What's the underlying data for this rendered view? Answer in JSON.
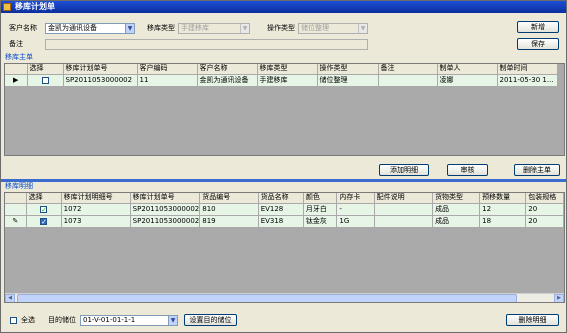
{
  "window": {
    "title": "移库计划单"
  },
  "form": {
    "customer_label": "客户名称",
    "customer_value": "金凯为通讯设备",
    "move_type_label": "移库类型",
    "move_type_value": "手建移库",
    "op_type_label": "操作类型",
    "op_type_value": "储位整理",
    "remark_label": "备注",
    "new_label": "新增",
    "save_label": "保存"
  },
  "master": {
    "section_title": "移库主单",
    "columns": [
      "选择",
      "移库计划单号",
      "客户编码",
      "客户名称",
      "移库类型",
      "操作类型",
      "备注",
      "制单人",
      "制单时间"
    ],
    "rows": [
      {
        "checked": false,
        "cells": [
          "SP2011053000002",
          "11",
          "金凯为通讯设备",
          "手建移库",
          "储位整理",
          "",
          "凌娜",
          "2011-05-30 1..."
        ]
      }
    ],
    "add_detail_label": "添加明细",
    "audit_label": "审核",
    "delete_main_label": "删除主单"
  },
  "detail": {
    "section_title": "移库明细",
    "columns": [
      "选择",
      "移库计划明细号",
      "移库计划单号",
      "货品编号",
      "货品名称",
      "颜色",
      "内存卡",
      "配件说明",
      "货物类型",
      "预移数量",
      "包装规格"
    ],
    "rows": [
      {
        "checked": true,
        "selected": false,
        "cells": [
          "1072",
          "SP2011053000002",
          "810",
          "EV128",
          "月牙白",
          "-",
          "",
          "成品",
          "12",
          "20"
        ]
      },
      {
        "checked": true,
        "selected": true,
        "cells": [
          "1073",
          "SP2011053000002",
          "819",
          "EV318",
          "钛金灰",
          "1G",
          "",
          "成品",
          "18",
          "20"
        ]
      }
    ]
  },
  "footer": {
    "select_all_label": "全选",
    "target_location_label": "目的储位",
    "target_location_value": "01-V-01-01-1-1",
    "set_location_label": "设置目的储位",
    "delete_detail_label": "删除明细"
  }
}
